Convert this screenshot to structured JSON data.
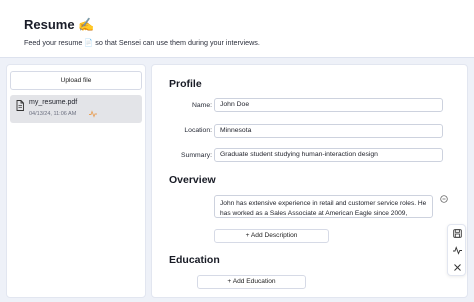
{
  "header": {
    "title": "Resume ✍️",
    "subtitle": "Feed your resume 📄 so that Sensei can use them during your interviews."
  },
  "sidebar": {
    "upload_label": "Upload file",
    "files": [
      {
        "name": "my_resume.pdf",
        "date": "04/13/24, 11:06 AM"
      }
    ]
  },
  "profile": {
    "title": "Profile",
    "name_label": "Name:",
    "name_value": "John Doe",
    "location_label": "Location:",
    "location_value": "Minnesota",
    "summary_label": "Summary:",
    "summary_value": "Graduate student studying human-interaction design"
  },
  "overview": {
    "title": "Overview",
    "text": "John has extensive experience in retail and customer service roles. He has worked as a Sales Associate at American Eagle since 2009,",
    "add_label": "+ Add Description"
  },
  "education": {
    "title": "Education",
    "add_label": "+ Add Education"
  },
  "toolbar": {
    "icons": [
      "save-icon",
      "activity-icon",
      "close-icon"
    ]
  },
  "colors": {
    "background": "#eef1f8",
    "panel": "#ffffff",
    "selected_file": "#e3e4e8",
    "accent_orange": "#e8a15a"
  }
}
